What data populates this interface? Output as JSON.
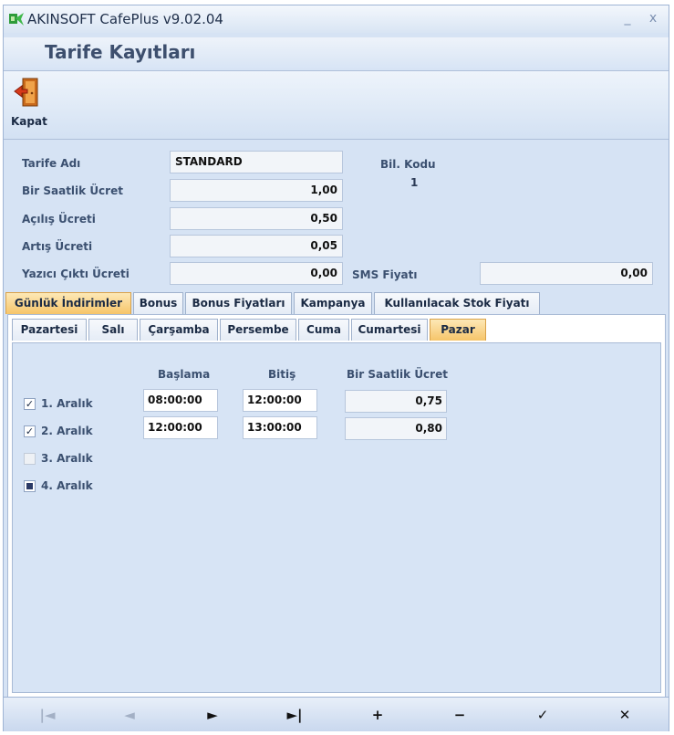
{
  "window": {
    "title": "AKINSOFT CafePlus v9.02.04",
    "minimize": "_",
    "close": "x"
  },
  "header": {
    "title": "Tarife Kayıtları"
  },
  "toolbar": {
    "close_label": "Kapat"
  },
  "form": {
    "tarife_adi_label": "Tarife Adı",
    "tarife_adi_value": "STANDARD",
    "bir_saatlik_label": "Bir Saatlik Ücret",
    "bir_saatlik_value": "1,00",
    "acilis_label": "Açılış Ücreti",
    "acilis_value": "0,50",
    "artis_label": "Artış Ücreti",
    "artis_value": "0,05",
    "yazici_label": "Yazıcı Çıktı Ücreti",
    "yazici_value": "0,00",
    "bil_kodu_label": "Bil. Kodu",
    "bil_kodu_value": "1",
    "sms_label": "SMS Fiyatı",
    "sms_value": "0,00"
  },
  "main_tabs": [
    {
      "label": "Günlük İndirimler",
      "active": true
    },
    {
      "label": "Bonus",
      "active": false
    },
    {
      "label": "Bonus Fiyatları",
      "active": false
    },
    {
      "label": "Kampanya",
      "active": false
    },
    {
      "label": "Kullanılacak Stok Fiyatı",
      "active": false
    }
  ],
  "day_tabs": [
    {
      "label": "Pazartesi",
      "active": false
    },
    {
      "label": "Salı",
      "active": false
    },
    {
      "label": "Çarşamba",
      "active": false
    },
    {
      "label": "Persembe",
      "active": false
    },
    {
      "label": "Cuma",
      "active": false
    },
    {
      "label": "Cumartesi",
      "active": false
    },
    {
      "label": "Pazar",
      "active": true
    }
  ],
  "intervals": {
    "col_start": "Başlama",
    "col_end": "Bitiş",
    "col_price": "Bir Saatlik Ücret",
    "rows": [
      {
        "label": "1. Aralık",
        "state": "checked",
        "start": "08:00:00",
        "end": "12:00:00",
        "price": "0,75"
      },
      {
        "label": "2. Aralık",
        "state": "checked",
        "start": "12:00:00",
        "end": "13:00:00",
        "price": "0,80"
      },
      {
        "label": "3. Aralık",
        "state": "unchecked"
      },
      {
        "label": "4. Aralık",
        "state": "indeterminate"
      }
    ]
  },
  "navigator": {
    "buttons": [
      {
        "name": "first-record-button",
        "glyph": "|◄",
        "enabled": false
      },
      {
        "name": "prior-record-button",
        "glyph": "◄",
        "enabled": false
      },
      {
        "name": "next-record-button",
        "glyph": "►",
        "enabled": true
      },
      {
        "name": "last-record-button",
        "glyph": "►|",
        "enabled": true
      },
      {
        "name": "insert-record-button",
        "glyph": "+",
        "enabled": true
      },
      {
        "name": "delete-record-button",
        "glyph": "−",
        "enabled": true
      },
      {
        "name": "post-record-button",
        "glyph": "✓",
        "enabled": true
      },
      {
        "name": "cancel-record-button",
        "glyph": "✕",
        "enabled": true
      }
    ]
  },
  "colors": {
    "active_tab": "#f6c56a",
    "panel_bg": "#d7e4f5",
    "label_text": "#3b5070"
  },
  "icons": {
    "app": "cafeplus-logo-icon",
    "close_toolbar": "exit-door-icon"
  }
}
